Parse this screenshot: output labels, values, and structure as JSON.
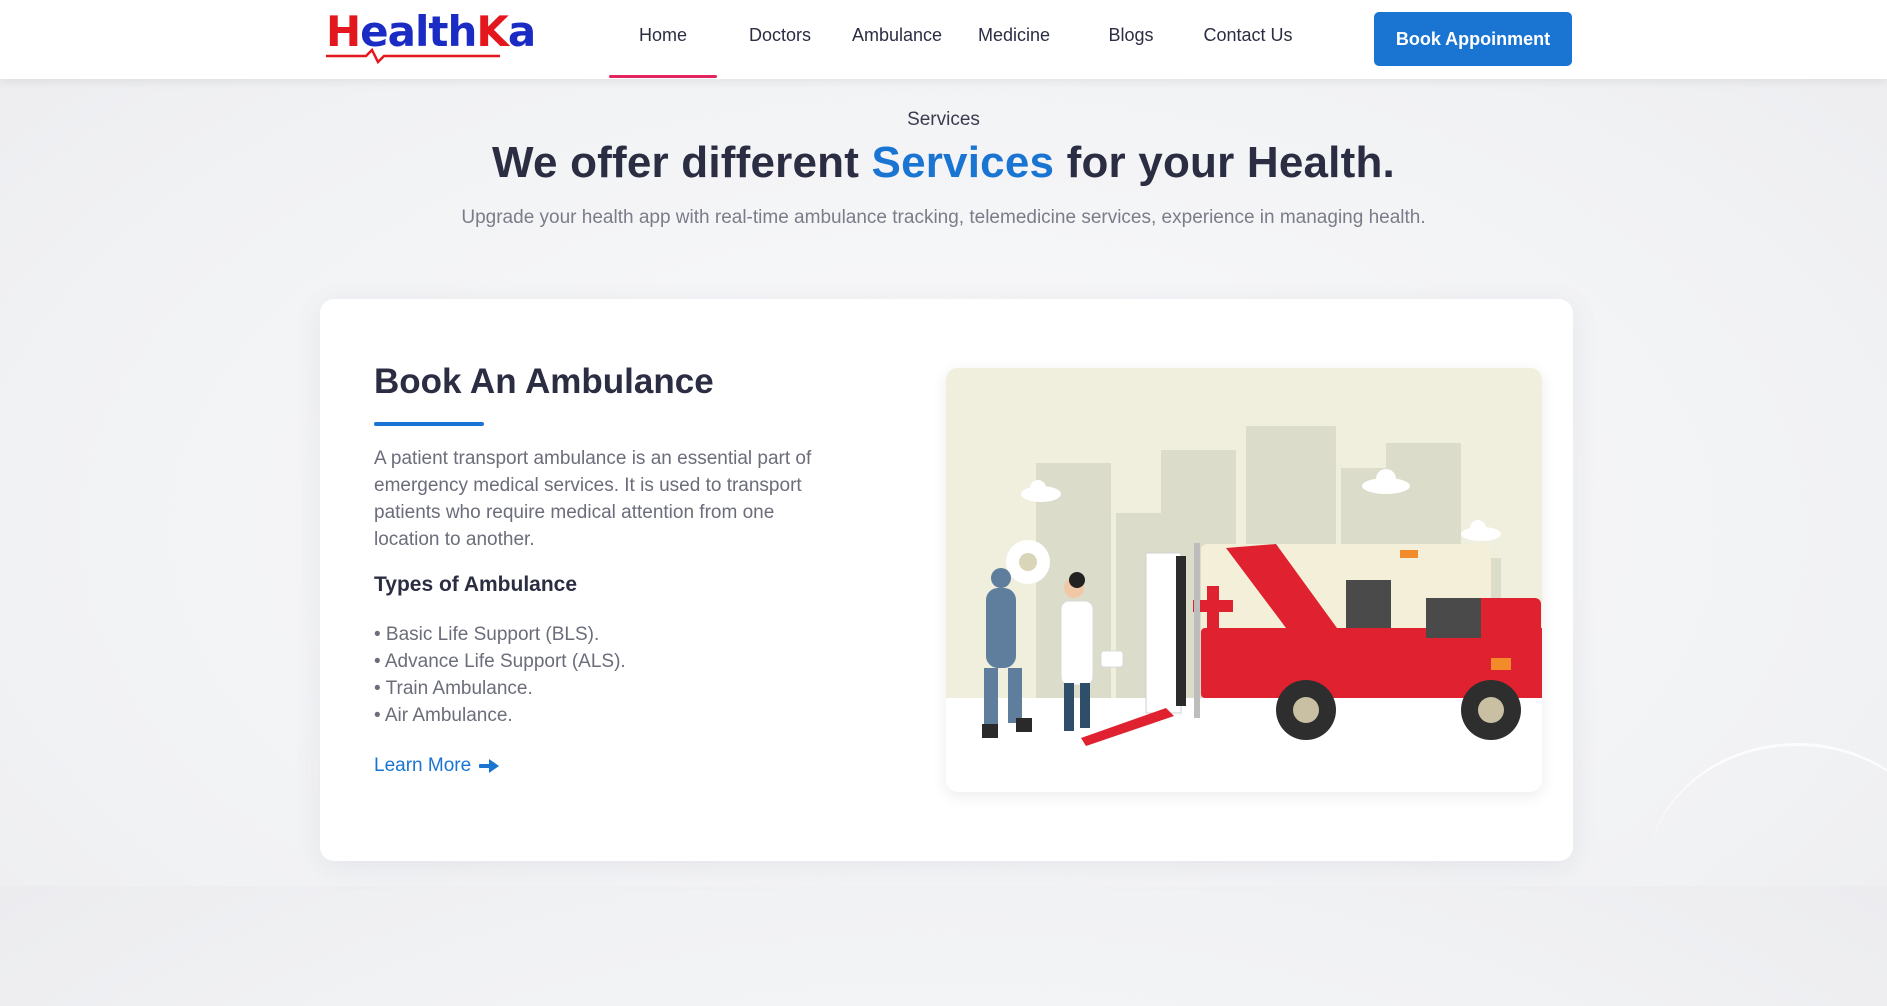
{
  "brand": {
    "logo_text": "HealthKa",
    "logo_h": "H",
    "logo_mid": "ealth",
    "logo_k": "K",
    "logo_end": "a",
    "colors": {
      "red": "#e4161e",
      "blue": "#1b2cc4"
    }
  },
  "nav": {
    "items": [
      {
        "label": "Home",
        "active": true
      },
      {
        "label": "Doctors"
      },
      {
        "label": "Ambulance"
      },
      {
        "label": "Medicine"
      },
      {
        "label": "Blogs"
      },
      {
        "label": "Contact Us"
      }
    ],
    "cta_label": "Book Appoinment",
    "accent": "#1a75d2",
    "active_indicator": "#e2245f"
  },
  "section": {
    "eyebrow": "Services",
    "title_pre": "We offer different ",
    "title_accent": "Services",
    "title_post": " for your Health.",
    "subtitle": "Upgrade your health app with real-time ambulance tracking, telemedicine services, experience in managing health."
  },
  "card": {
    "title": "Book An Ambulance",
    "description": "A patient transport ambulance is an essential part of emergency medical services. It is used to transport patients who require medical attention from one location to another.",
    "types_title": "Types of Ambulance",
    "types": [
      "• Basic Life Support (BLS).",
      "• Advance Life Support (ALS).",
      "• Train Ambulance.",
      "• Air Ambulance."
    ],
    "learn_more": "Learn More",
    "learn_icon": "arrow-right-icon",
    "illustration": "ambulance-illustration"
  }
}
